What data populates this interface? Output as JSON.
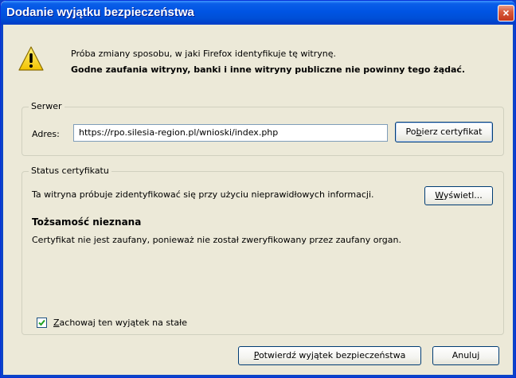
{
  "window": {
    "title": "Dodanie wyjątku bezpieczeństwa",
    "close_label": "×"
  },
  "message": {
    "line1": "Próba zmiany sposobu, w jaki Firefox identyfikuje tę witrynę.",
    "line2": "Godne zaufania witryny, banki i inne witryny publiczne nie powinny tego żądać.",
    "icon": "warning-icon"
  },
  "server": {
    "legend": "Serwer",
    "address_label": "Adres:",
    "address_value": "https://rpo.silesia-region.pl/wnioski/index.php",
    "get_cert_pre": "Po",
    "get_cert_key": "b",
    "get_cert_post": "ierz certyfikat"
  },
  "status": {
    "legend": "Status certyfikatu",
    "text1": "Ta witryna próbuje zidentyfikować się przy użyciu nieprawidłowych informacji.",
    "view_key": "W",
    "view_post": "yświetl...",
    "heading": "Tożsamość nieznana",
    "text2": "Certyfikat nie jest zaufany, ponieważ nie został zweryfikowany przez zaufany organ.",
    "checkbox_checked": true,
    "checkbox_key": "Z",
    "checkbox_post": "achowaj ten wyjątek na stałe"
  },
  "buttons": {
    "confirm_key": "P",
    "confirm_post": "otwierdź wyjątek bezpieczeństwa",
    "cancel": "Anuluj"
  },
  "colors": {
    "title_bar": "#0054e3",
    "dialog_bg": "#ece9d8",
    "close_button": "#d85b3c",
    "warning_yellow": "#f9d71c"
  }
}
